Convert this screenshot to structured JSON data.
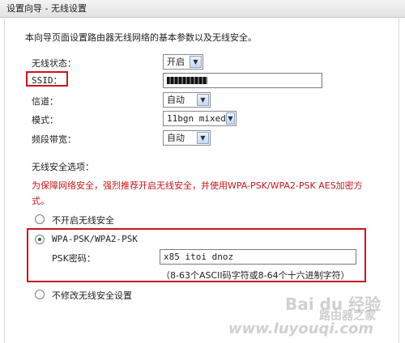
{
  "window": {
    "title": "设置向导 - 无线设置"
  },
  "intro": "本向导页面设置路由器无线网络的基本参数以及无线安全。",
  "fields": {
    "wireless_status": {
      "label": "无线状态：",
      "value": "开启"
    },
    "ssid": {
      "label": "SSID："
    },
    "channel": {
      "label": "信道：",
      "value": "自动"
    },
    "mode": {
      "label": "模式：",
      "value": "11bgn mixed"
    },
    "bandwidth": {
      "label": "频段带宽：",
      "value": "自动"
    }
  },
  "security": {
    "heading": "无线安全选项：",
    "warning": "为保障网络安全，强烈推荐开启无线安全，并使用WPA-PSK/WPA2-PSK AES加密方式。",
    "option_none": "不开启无线安全",
    "option_wpa": "WPA-PSK/WPA2-PSK",
    "psk_label": "PSK密码：",
    "psk_value": "x85 itoi dnoz",
    "psk_hint": "（8-63个ASCII码字符或8-64个十六进制字符）",
    "option_keep": "不修改无线安全设置"
  },
  "watermark": {
    "brand": "Bai du 经验",
    "site": "路由器之家",
    "url": "www.luyouqi.com"
  },
  "colors": {
    "highlight_red": "#c8161d"
  }
}
